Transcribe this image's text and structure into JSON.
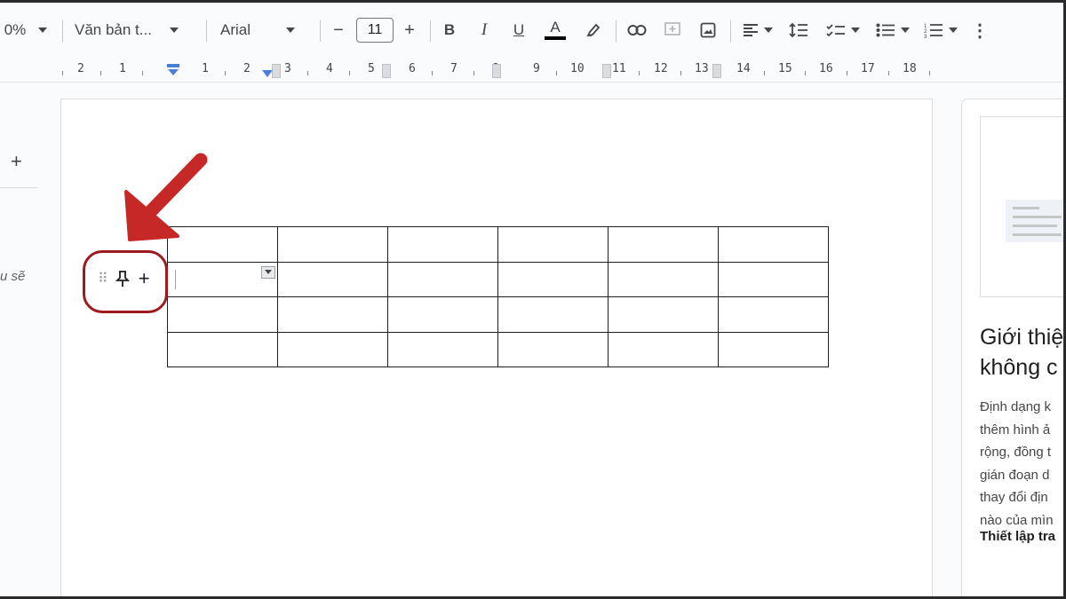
{
  "toolbar": {
    "zoom": "0%",
    "style": "Văn bản t...",
    "font": "Arial",
    "font_size": "11",
    "minus": "−",
    "plus": "+",
    "bold": "B",
    "italic": "I",
    "underline": "U",
    "text_color": "A",
    "more": "⋮"
  },
  "ruler": {
    "numbers": [
      "2",
      "1",
      "1",
      "2",
      "3",
      "4",
      "5",
      "6",
      "7",
      "8",
      "9",
      "10",
      "11",
      "12",
      "13",
      "14",
      "15",
      "16",
      "17",
      "18"
    ]
  },
  "sidebar": {
    "add": "+",
    "partial_text": "u sẽ"
  },
  "table": {
    "rows": 4,
    "cols": 6
  },
  "row_handle": {
    "dots": "⠿",
    "plus": "+"
  },
  "right_panel": {
    "title_line1": "Giới thiệ",
    "title_line2": "không c",
    "body_lines": [
      "Định dạng k",
      "thêm hình ả",
      "rộng, đồng t",
      "gián đoạn d",
      "thay đổi địn",
      "nào của mìn"
    ],
    "bold_line": "Thiết lập tra"
  },
  "colors": {
    "annotation": "#c62828",
    "circle": "#9e1b1b"
  }
}
